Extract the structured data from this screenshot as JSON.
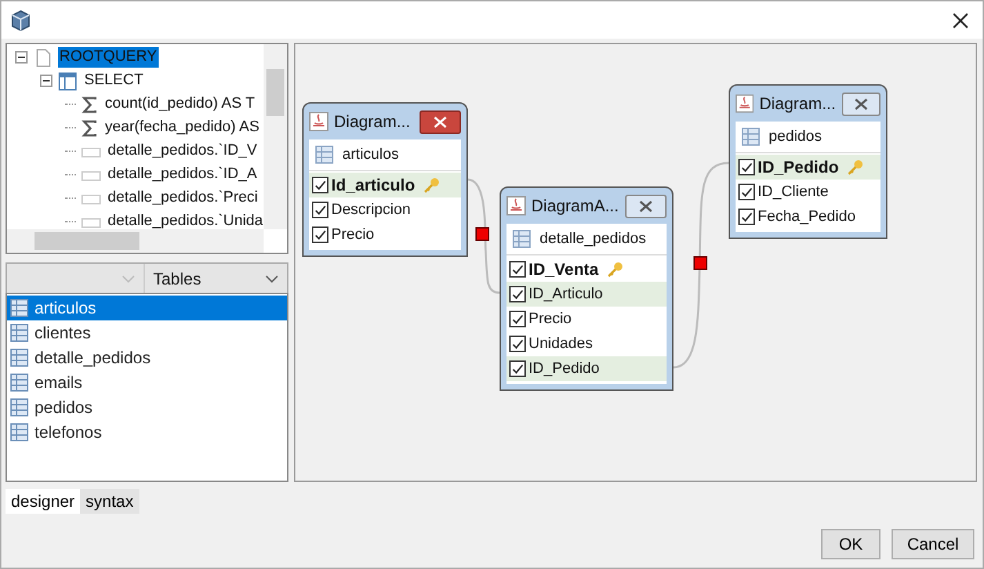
{
  "tree": [
    {
      "label": "ROOTQUERY",
      "kind": "root",
      "selected": true,
      "expanded": true,
      "children": [
        {
          "label": "SELECT",
          "kind": "select",
          "selected": false,
          "expanded": true,
          "children": [
            {
              "label": "count(id_pedido) AS T",
              "kind": "aggregate",
              "selected": false
            },
            {
              "label": "year(fecha_pedido) AS",
              "kind": "aggregate",
              "selected": false
            },
            {
              "label": "detalle_pedidos.`ID_V",
              "kind": "field",
              "selected": false
            },
            {
              "label": "detalle_pedidos.`ID_A",
              "kind": "field",
              "selected": false
            },
            {
              "label": "detalle_pedidos.`Preci",
              "kind": "field",
              "selected": false
            },
            {
              "label": "detalle_pedidos.`Unida",
              "kind": "field",
              "selected": false
            }
          ]
        }
      ]
    }
  ],
  "object_filter": {
    "value": "Tables"
  },
  "tables": [
    {
      "label": "articulos",
      "selected": true
    },
    {
      "label": "clientes",
      "selected": false
    },
    {
      "label": "detalle_pedidos",
      "selected": false
    },
    {
      "label": "emails",
      "selected": false
    },
    {
      "label": "pedidos",
      "selected": false
    },
    {
      "label": "telefonos",
      "selected": false
    }
  ],
  "diagram_windows": [
    {
      "title": "Diagram...",
      "active": true,
      "table": "articulos",
      "columns": [
        {
          "name": "Id_articulo",
          "checked": true,
          "primary_key": true,
          "highlighted": true
        },
        {
          "name": "Descripcion",
          "checked": true,
          "primary_key": false,
          "highlighted": false
        },
        {
          "name": "Precio",
          "checked": true,
          "primary_key": false,
          "highlighted": false
        }
      ]
    },
    {
      "title": "DiagramA...",
      "active": false,
      "table": "detalle_pedidos",
      "columns": [
        {
          "name": "ID_Venta",
          "checked": true,
          "primary_key": true,
          "highlighted": false
        },
        {
          "name": "ID_Articulo",
          "checked": true,
          "primary_key": false,
          "highlighted": true
        },
        {
          "name": "Precio",
          "checked": true,
          "primary_key": false,
          "highlighted": false
        },
        {
          "name": "Unidades",
          "checked": true,
          "primary_key": false,
          "highlighted": false
        },
        {
          "name": "ID_Pedido",
          "checked": true,
          "primary_key": false,
          "highlighted": true
        }
      ]
    },
    {
      "title": "Diagram...",
      "active": false,
      "table": "pedidos",
      "columns": [
        {
          "name": "ID_Pedido",
          "checked": true,
          "primary_key": true,
          "highlighted": true
        },
        {
          "name": "ID_Cliente",
          "checked": true,
          "primary_key": false,
          "highlighted": false
        },
        {
          "name": "Fecha_Pedido",
          "checked": true,
          "primary_key": false,
          "highlighted": false
        }
      ]
    }
  ],
  "tabs": [
    {
      "label": "designer",
      "selected": true
    },
    {
      "label": "syntax",
      "selected": false
    }
  ],
  "buttons": [
    "OK",
    "Cancel"
  ]
}
